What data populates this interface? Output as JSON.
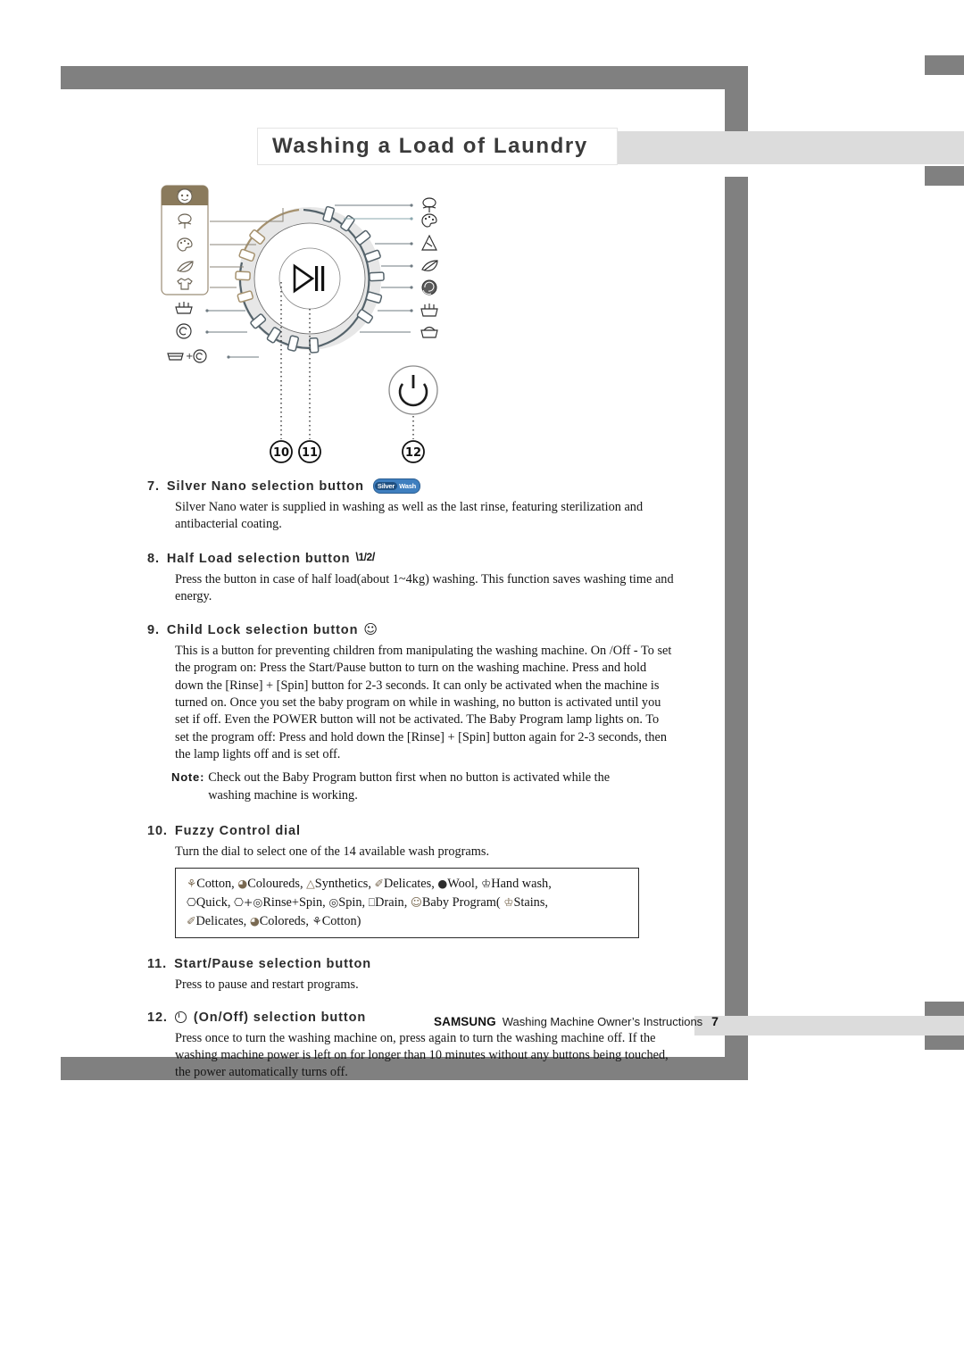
{
  "page": {
    "title": "Washing a Load of Laundry",
    "number": "7"
  },
  "colors": {
    "frame_gray": "#808080",
    "band_gray": "#dcdcdc",
    "heading_gray": "#2b2b2b",
    "dial_ring_gray": "#e3e3e3",
    "dial_tick_dark": "#55636b",
    "dial_tick_tan": "#a5916e",
    "baby_panel_brown": "#8a7a5c",
    "silverwash_blue": "#3f7fbf",
    "silverwash_dark_blue": "#1f4f80"
  },
  "diagram": {
    "name": "washing-machine-control-panel",
    "callouts": [
      {
        "id": "10",
        "label": "10",
        "target": "fuzzy-control-dial"
      },
      {
        "id": "11",
        "label": "11",
        "target": "start-pause-button"
      },
      {
        "id": "12",
        "label": "12",
        "target": "on-off-button"
      }
    ],
    "left_icons": [
      "baby-program-icon",
      "cotton-icon",
      "coloureds-icon",
      "delicates-icon",
      "stains-icon",
      "hand-wash-icon",
      "spin-icon",
      "rinse-plus-spin-icon"
    ],
    "right_icons": [
      "cotton-icon",
      "coloureds-icon",
      "synthetics-icon",
      "delicates-icon",
      "wool-icon",
      "hand-wash-icon",
      "quick-icon"
    ],
    "center_button_icon": "play-pause-icon",
    "power_button_icon": "power-icon"
  },
  "sections": [
    {
      "number": "7.",
      "title": "Silver Nano selection button",
      "icon": "silverwash-badge",
      "badge": {
        "left": "Silver",
        "right": "Wash"
      },
      "body": "Silver Nano water is supplied in washing as well as the last rinse, featuring sterilization and antibacterial coating."
    },
    {
      "number": "8.",
      "title": "Half Load selection button",
      "icon": "half-load-icon",
      "icon_text": "1/2",
      "body": "Press the button in case of half load(about 1~4kg) washing. This function saves washing time and energy."
    },
    {
      "number": "9.",
      "title": "Child Lock selection button",
      "icon": "child-face-icon",
      "body": "This is a button for preventing children from manipulating the washing machine. On /Off - To set the program on: Press the Start/Pause button to turn on the washing machine. Press and hold down the [Rinse] + [Spin] button for 2-3 seconds. It can only be activated when the machine is turned on. Once you set the baby program on while in washing, no button is activated until you set if off. Even the POWER button will not be activated. The Baby Program lamp lights on. To set the program off: Press and hold down the [Rinse] + [Spin] button again for 2-3 seconds, then the lamp lights off and is set off.",
      "note": {
        "label": "Note:",
        "text": "Check out the Baby Program button first when no button is activated while the washing machine is working."
      }
    },
    {
      "number": "10.",
      "title": "Fuzzy Control dial",
      "body": "Turn the dial to select one of the 14 available wash programs.",
      "program_box": {
        "rows": [
          [
            {
              "icon": "cotton-icon",
              "glyph": "⚘",
              "label": "Cotton,"
            },
            {
              "icon": "coloureds-icon",
              "glyph": "◔",
              "label": "Coloureds,"
            },
            {
              "icon": "synthetics-icon",
              "glyph": "△",
              "label": "Synthetics,"
            },
            {
              "icon": "delicates-icon",
              "glyph": "✐",
              "label": "Delicates,"
            },
            {
              "icon": "wool-icon",
              "glyph": "●",
              "label": "Wool,"
            },
            {
              "icon": "hand-wash-icon",
              "glyph": "♓",
              "label": "Hand wash,"
            }
          ],
          [
            {
              "icon": "quick-icon",
              "glyph": "⊔",
              "label": "Quick,"
            },
            {
              "icon": "rinse-plus-spin-icon",
              "glyph": "⊔+◎",
              "label": "Rinse+Spin,"
            },
            {
              "icon": "spin-icon",
              "glyph": "◎",
              "label": "Spin,"
            },
            {
              "icon": "drain-icon",
              "glyph": "⊓",
              "label": "Drain,"
            },
            {
              "icon": "baby-program-icon",
              "glyph": "☺",
              "label": "Baby Program("
            },
            {
              "icon": "stains-icon",
              "glyph": "☂",
              "label": "Stains,"
            }
          ],
          [
            {
              "icon": "delicates-icon",
              "glyph": "✐",
              "label": "Delicates,"
            },
            {
              "icon": "coloureds-icon",
              "glyph": "◔",
              "label": "Coloreds,"
            },
            {
              "icon": "cotton-icon",
              "glyph": "⚘",
              "label": "Cotton)"
            }
          ]
        ]
      }
    },
    {
      "number": "11.",
      "title": "Start/Pause selection button",
      "body": "Press to pause and restart programs."
    },
    {
      "number": "12.",
      "title": "(On/Off) selection button",
      "icon": "power-icon",
      "body": "Press once to turn the washing machine on, press again to turn the washing machine off. If the washing machine power is left on for longer than 10 minutes without any buttons being touched, the power automatically turns off."
    }
  ],
  "footer": {
    "brand": "SAMSUNG",
    "text": "Washing Machine Owner’s Instructions",
    "page": "7"
  }
}
